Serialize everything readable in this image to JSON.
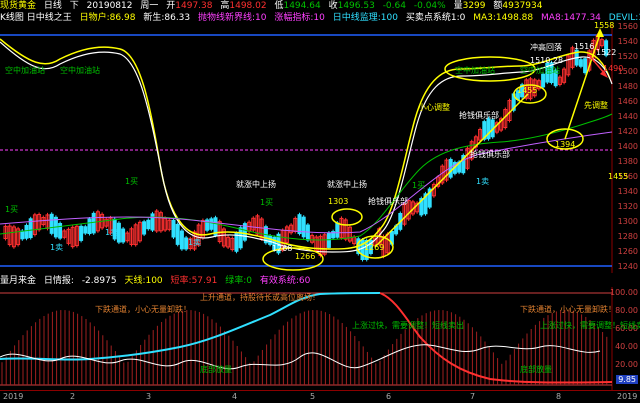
{
  "header": {
    "symbol": "现货黄金",
    "period": "日线",
    "direction": "下",
    "date": "20190812",
    "weekday": "周一",
    "open_label": "开",
    "open": "1497.38",
    "high_label": "高",
    "high": "1498.02",
    "low_label": "低",
    "low": "1494.64",
    "close_label": "收",
    "close": "1496.53",
    "change": "-0.64",
    "change_pct": "-0.04%",
    "volume_label": "量",
    "volume": "3299",
    "amount_label": "额",
    "amount": "4937934"
  },
  "indicator_bar": {
    "name": "K线图 日中线之王",
    "items": [
      "日物户:86.98",
      "新生:86.33",
      "抛物线新界线:10",
      "涨幅指标:10",
      "日中线监理:100",
      "买卖点系统1:0",
      "MA3:1498.88",
      "MA8:1477.34",
      "DEVIL:1467.26"
    ]
  },
  "sub_bar": {
    "name": "量月来金",
    "mode": "日情报:",
    "items": [
      "-2.8975",
      "天线:100",
      "短率:57.91",
      "绿率:0",
      "有效系统:60"
    ]
  },
  "main_axis": {
    "labels": [
      "1560",
      "1540",
      "1520",
      "1500",
      "1480",
      "1460",
      "1440",
      "1420",
      "1400",
      "1380",
      "1360",
      "1340",
      "1320",
      "1300",
      "1280",
      "1260",
      "1240"
    ]
  },
  "sub_axis": {
    "labels": [
      "100.00",
      "80.00",
      "60.00",
      "40.00",
      "20.00",
      "0.00"
    ],
    "last_value": "9.85"
  },
  "x_axis": {
    "labels": [
      "2019",
      "2",
      "3",
      "4",
      "5",
      "6",
      "7",
      "8",
      "2019"
    ]
  },
  "annotations": {
    "price_1558": "1558",
    "price_1522": "1522",
    "price_1516": "1516",
    "price_1490": "1490",
    "price_1510": "1510.28",
    "price_1455a": "1455",
    "price_1455b": "1455",
    "price_1394": "1394",
    "price_1303": "1303",
    "price_1269": "1269",
    "price_1266": "1266",
    "price_1268": "1268",
    "zone_air": "空中加油站",
    "high_area": "冲高回落",
    "careful": "小心调整",
    "rally": "抢钱俱乐部",
    "take_off": "先调整",
    "buy_zone": "抢钱俱乐部",
    "rise1": "就涨中上扬",
    "rise2": "就涨中上扬",
    "buy": "1买",
    "sell": "1卖",
    "down_channel1": "下跌通道，小心无量卸跌！",
    "down_channel2": "下跌通道，小心无量卸跌！",
    "up_channel": "上升通道，持股待长或高位离场！",
    "up_channel2": "上涨过快，需要调整！短线卖出",
    "bottom1": "底部放量",
    "bottom2": "底部放量",
    "mid_label": "中期预警"
  },
  "colors": {
    "candle_up": "#ff3030",
    "candle_down": "#30e0ff",
    "ma_yellow": "#ffff00",
    "ma_white": "#ffffff",
    "ma_green": "#00c000",
    "ma_magenta": "#ff40ff",
    "axis_red": "#d04040"
  }
}
